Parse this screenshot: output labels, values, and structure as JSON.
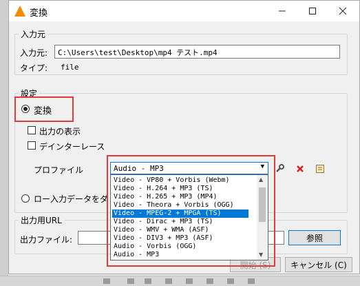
{
  "window": {
    "title": "変換",
    "minimize_icon": "minimize-icon",
    "maximize_icon": "maximize-icon",
    "close_icon": "close-icon"
  },
  "source": {
    "group_label": "入力元",
    "input_label": "入力元:",
    "input_value": "C:\\Users\\test\\Desktop\\mp4 テスト.mp4",
    "type_label": "タイプ:",
    "type_value": "file"
  },
  "settings": {
    "group_label": "設定",
    "convert_label": "変換",
    "show_output_label": "出力の表示",
    "deinterlace_label": "デインターレース",
    "profile_label": "プロファイル",
    "profile_selected": "Audio - MP3",
    "profile_options": [
      "Video - VP80 + Vorbis (Webm)",
      "Video - H.264 + MP3 (TS)",
      "Video - H.265 + MP3 (MP4)",
      "Video - Theora + Vorbis (OGG)",
      "Video - MPEG-2 + MPGA (TS)",
      "Video - Dirac + MP3 (TS)",
      "Video - WMV + WMA (ASF)",
      "Video - DIV3 + MP3 (ASF)",
      "Audio - Vorbis (OGG)",
      "Audio - MP3"
    ],
    "highlighted_index": 4,
    "raw_dump_label": "ロー入力データをダ"
  },
  "output": {
    "group_label": "出力用URL",
    "file_label": "出力ファイル:",
    "file_value": "",
    "browse_label": "参照"
  },
  "buttons": {
    "start_label": "開始 (S)",
    "cancel_label": "キャンセル (C)"
  },
  "colors": {
    "accent": "#0078d7",
    "highlight_box": "#e03a3a",
    "vlc_orange": "#f28a00",
    "delete_red": "#d42020"
  }
}
